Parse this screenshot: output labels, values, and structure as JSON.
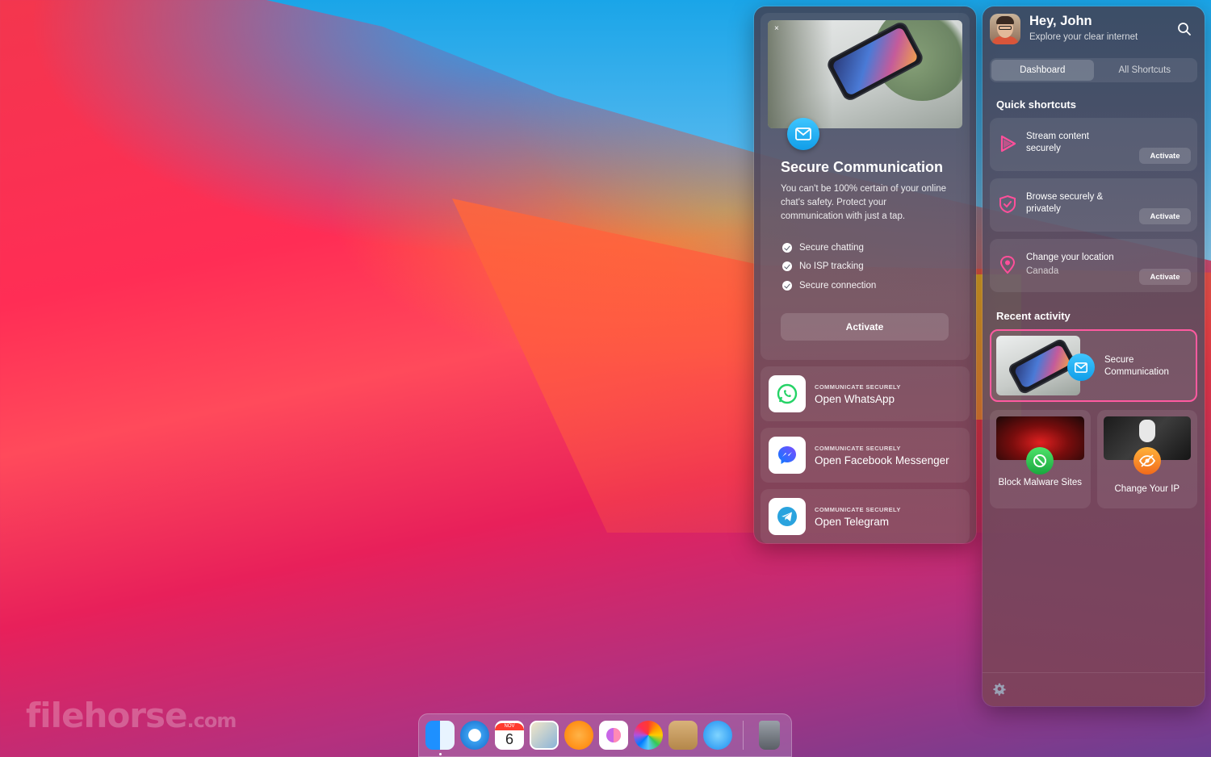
{
  "watermark": {
    "brand": "filehorse",
    "suffix": ".com"
  },
  "left_panel": {
    "close_label": "×",
    "feature": {
      "title": "Secure Communication",
      "description": "You can't be 100% certain of your online chat's safety. Protect your communication with just a tap.",
      "bullets": [
        "Secure chatting",
        "No ISP tracking",
        "Secure connection"
      ],
      "activate_label": "Activate"
    },
    "apps": [
      {
        "kicker": "COMMUNICATE SECURELY",
        "label": "Open WhatsApp",
        "icon": "whatsapp-icon"
      },
      {
        "kicker": "COMMUNICATE SECURELY",
        "label": "Open Facebook Messenger",
        "icon": "messenger-icon"
      },
      {
        "kicker": "COMMUNICATE SECURELY",
        "label": "Open Telegram",
        "icon": "telegram-icon"
      }
    ]
  },
  "right_panel": {
    "greeting": "Hey, John",
    "subtitle": "Explore your clear internet",
    "tabs": [
      "Dashboard",
      "All Shortcuts"
    ],
    "active_tab": "Dashboard",
    "quick_shortcuts_title": "Quick shortcuts",
    "shortcuts": [
      {
        "title": "Stream content securely",
        "subtitle": "",
        "button": "Activate",
        "icon": "play-icon"
      },
      {
        "title": "Browse securely & privately",
        "subtitle": "",
        "button": "Activate",
        "icon": "shield-icon"
      },
      {
        "title": "Change your location",
        "subtitle": "Canada",
        "button": "Activate",
        "icon": "location-pin-icon"
      }
    ],
    "recent_title": "Recent activity",
    "recent_main": {
      "label": "Secure Communication"
    },
    "recent_tiles": [
      {
        "label": "Block Malware Sites"
      },
      {
        "label": "Change Your IP"
      }
    ]
  },
  "dock": {
    "calendar_month": "NOV",
    "calendar_day": "6"
  },
  "colors": {
    "accent_pink": "#ff5aa0",
    "mail_blue": "#119ee8",
    "malware_green": "#1aa73e",
    "ip_orange": "#f26a1b"
  }
}
